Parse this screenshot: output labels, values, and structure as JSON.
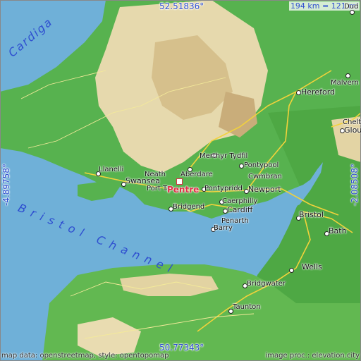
{
  "map": {
    "focus_place": "Pentre",
    "coords": {
      "top": "52.51836°",
      "bottom": "50.77343°",
      "left": "-4.89758°",
      "right": "-2.08508°"
    },
    "scale": "194 km = 121 mi",
    "sea_labels": [
      "Cardiga",
      "Bristol Channel"
    ],
    "footer": {
      "left": "map data: openstreetmap, style: opentopomap",
      "right": "image proc.: elevation.city"
    },
    "places": [
      "Hereford",
      "Malvern",
      "Glou",
      "Chelt",
      "Merthyr Tydfil",
      "Aberdare",
      "Pontypool",
      "Cwmbran",
      "Llanelli",
      "Swansea",
      "Neath",
      "Port Ta",
      "Pontypridd",
      "Newport",
      "Caerphilly",
      "Bridgend",
      "Cardiff",
      "Penarth",
      "Barry",
      "Bristol",
      "Bath",
      "Wells",
      "Bridgwater",
      "Taunton",
      "Dud"
    ],
    "colors": {
      "sea": "#6fb0d8",
      "lowland": "#4caf50",
      "upland": "#e8dcb0",
      "accent": "#2f4fd0",
      "focus": "#e0314b"
    }
  }
}
